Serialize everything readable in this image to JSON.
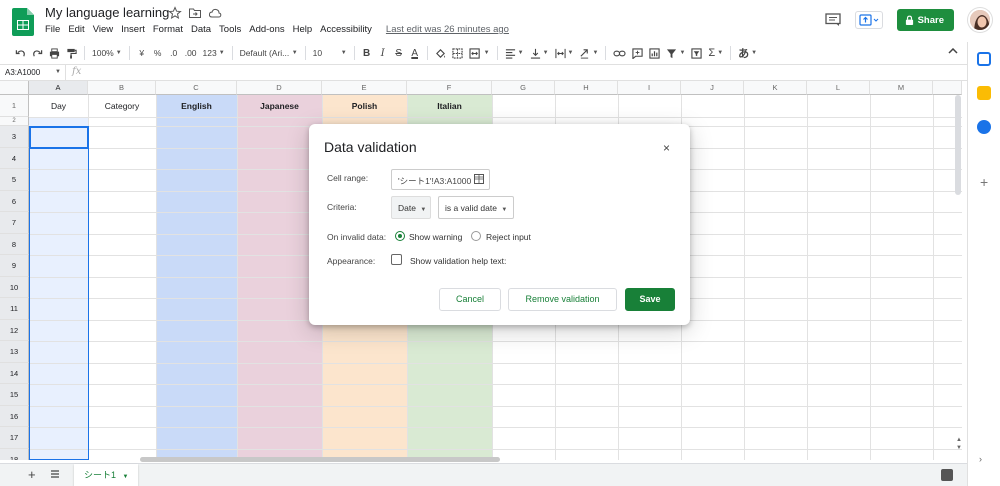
{
  "document": {
    "title": "My language learning"
  },
  "menu": [
    "File",
    "Edit",
    "View",
    "Insert",
    "Format",
    "Data",
    "Tools",
    "Add-ons",
    "Help",
    "Accessibility"
  ],
  "last_edit": "Last edit was 26 minutes ago",
  "header": {
    "share_label": "Share"
  },
  "toolbar": {
    "zoom": "100%",
    "currency": "¥",
    "percent": "%",
    "decrease_decimal": ".0",
    "increase_decimal": ".00",
    "more_formats": "123",
    "font": "Default (Ari...",
    "font_size": "10",
    "bold": "B",
    "italic": "I",
    "strike": "S",
    "text_color": "A",
    "sigma": "Σ",
    "input_tools": "あ"
  },
  "formula_bar": {
    "name_box": "A3:A1000",
    "fx": "fx"
  },
  "grid": {
    "columns": [
      "A",
      "B",
      "C",
      "D",
      "E",
      "F",
      "G",
      "H",
      "I",
      "J",
      "K",
      "L",
      "M"
    ],
    "rows": [
      "1",
      "2",
      "3",
      "4",
      "5",
      "6",
      "7",
      "8",
      "9",
      "10",
      "11",
      "12",
      "13",
      "14",
      "15",
      "16",
      "17",
      "18"
    ],
    "header_cells": [
      "Day",
      "Category",
      "English",
      "Japanese",
      "Polish",
      "Italian"
    ],
    "column_colors": {
      "A": "#e8f0fe",
      "C": "#c9daf8",
      "D": "#ead1dc",
      "E": "#fce5cd",
      "F": "#d9ead3"
    }
  },
  "sheet": {
    "tab_label": "シート1",
    "add_label": "+"
  },
  "dialog": {
    "title": "Data validation",
    "close": "×",
    "cell_range_label": "Cell range:",
    "cell_range_value": "'シート1'!A3:A1000",
    "criteria_label": "Criteria:",
    "criteria_type": "Date",
    "criteria_condition": "is a valid date",
    "invalid_label": "On invalid data:",
    "show_warning": "Show warning",
    "reject_input": "Reject input",
    "appearance_label": "Appearance:",
    "help_text_label": "Show validation help text:",
    "cancel": "Cancel",
    "remove": "Remove validation",
    "save": "Save"
  }
}
